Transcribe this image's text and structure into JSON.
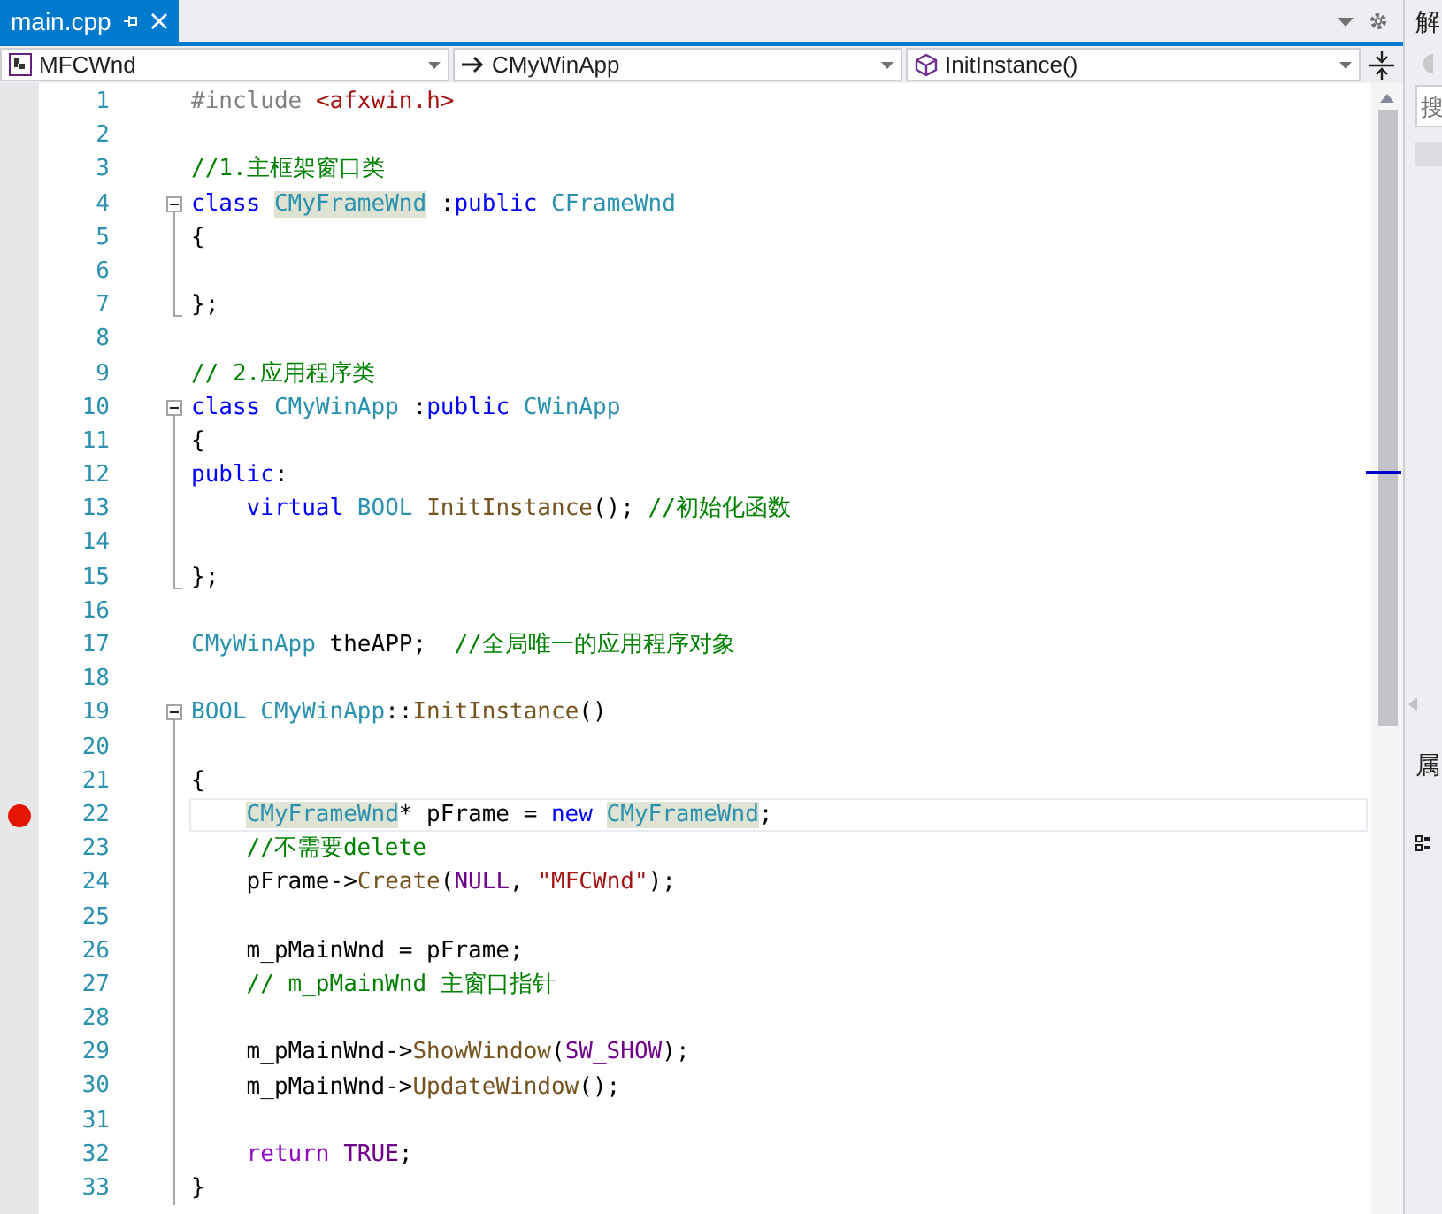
{
  "tabs": [
    {
      "label": "main.cpp",
      "selected": true
    }
  ],
  "navigation": [
    {
      "kind": "project",
      "text": "MFCWnd"
    },
    {
      "kind": "class",
      "text": "CMyWinApp"
    },
    {
      "kind": "member",
      "text": "InitInstance()"
    }
  ],
  "editor": {
    "lines": [
      {
        "number": "1",
        "breakpoint": false,
        "current": false,
        "kind": "plain",
        "indented": false,
        "tokens": [
          {
            "kind": "preproc",
            "text": "#include "
          },
          {
            "kind": "string",
            "text": "<afxwin.h>"
          }
        ]
      },
      {
        "number": "2",
        "breakpoint": false,
        "current": false,
        "kind": "plain"
      },
      {
        "number": "3",
        "breakpoint": false,
        "current": false,
        "kind": "plain",
        "indented": false,
        "tokens": [
          {
            "kind": "comment",
            "text": "//1.主框架窗口类"
          }
        ]
      },
      {
        "number": "4",
        "breakpoint": false,
        "current": false,
        "kind": "block-start",
        "indented": false,
        "tokens": [
          {
            "kind": "keyword",
            "text": "class "
          },
          {
            "kind": "type-ref",
            "text": "CMyFrameWnd"
          },
          {
            "kind": "plain",
            "text": " :"
          },
          {
            "kind": "keyword",
            "text": "public "
          },
          {
            "kind": "type",
            "text": "CFrameWnd"
          }
        ]
      },
      {
        "number": "5",
        "breakpoint": false,
        "current": false,
        "kind": "block-inside",
        "indented": false,
        "tokens": [
          {
            "kind": "plain",
            "text": "{"
          }
        ]
      },
      {
        "number": "6",
        "breakpoint": false,
        "current": false,
        "kind": "block-inside"
      },
      {
        "number": "7",
        "breakpoint": false,
        "current": false,
        "kind": "block-end",
        "indented": false,
        "tokens": [
          {
            "kind": "plain",
            "text": "};"
          }
        ]
      },
      {
        "number": "8",
        "breakpoint": false,
        "current": false,
        "kind": "plain"
      },
      {
        "number": "9",
        "breakpoint": false,
        "current": false,
        "kind": "plain",
        "indented": false,
        "tokens": [
          {
            "kind": "comment",
            "text": "// 2.应用程序类"
          }
        ]
      },
      {
        "number": "10",
        "breakpoint": false,
        "current": false,
        "kind": "block-start",
        "indented": false,
        "tokens": [
          {
            "kind": "keyword",
            "text": "class "
          },
          {
            "kind": "type",
            "text": "CMyWinApp"
          },
          {
            "kind": "plain",
            "text": " :"
          },
          {
            "kind": "keyword",
            "text": "public "
          },
          {
            "kind": "type",
            "text": "CWinApp"
          }
        ]
      },
      {
        "number": "11",
        "breakpoint": false,
        "current": false,
        "kind": "block-inside",
        "indented": false,
        "tokens": [
          {
            "kind": "plain",
            "text": "{"
          }
        ]
      },
      {
        "number": "12",
        "breakpoint": false,
        "current": false,
        "kind": "block-inside",
        "indented": false,
        "tokens": [
          {
            "kind": "keyword",
            "text": "public"
          },
          {
            "kind": "plain",
            "text": ":"
          }
        ]
      },
      {
        "number": "13",
        "breakpoint": false,
        "current": false,
        "kind": "block-inside",
        "indented": true,
        "tokens": [
          {
            "kind": "keyword",
            "text": "virtual "
          },
          {
            "kind": "type",
            "text": "BOOL "
          },
          {
            "kind": "function",
            "text": "InitInstance"
          },
          {
            "kind": "plain",
            "text": "(); "
          },
          {
            "kind": "comment",
            "text": "//初始化函数"
          }
        ]
      },
      {
        "number": "14",
        "breakpoint": false,
        "current": false,
        "kind": "block-inside"
      },
      {
        "number": "15",
        "breakpoint": false,
        "current": false,
        "kind": "block-end",
        "indented": false,
        "tokens": [
          {
            "kind": "plain",
            "text": "};"
          }
        ]
      },
      {
        "number": "16",
        "breakpoint": false,
        "current": false,
        "kind": "plain"
      },
      {
        "number": "17",
        "breakpoint": false,
        "current": false,
        "kind": "plain",
        "indented": false,
        "tokens": [
          {
            "kind": "type",
            "text": "CMyWinApp"
          },
          {
            "kind": "plain",
            "text": " theAPP;  "
          },
          {
            "kind": "comment",
            "text": "//全局唯一的应用程序对象"
          }
        ]
      },
      {
        "number": "18",
        "breakpoint": false,
        "current": false,
        "kind": "plain"
      },
      {
        "number": "19",
        "breakpoint": false,
        "current": false,
        "kind": "block-start",
        "indented": false,
        "tokens": [
          {
            "kind": "type",
            "text": "BOOL CMyWinApp"
          },
          {
            "kind": "plain",
            "text": "::"
          },
          {
            "kind": "function",
            "text": "InitInstance"
          },
          {
            "kind": "plain",
            "text": "()"
          }
        ]
      },
      {
        "number": "20",
        "breakpoint": false,
        "current": false,
        "kind": "block-inside"
      },
      {
        "number": "21",
        "breakpoint": false,
        "current": false,
        "kind": "block-inside",
        "indented": false,
        "tokens": [
          {
            "kind": "plain",
            "text": "{"
          }
        ]
      },
      {
        "number": "22",
        "breakpoint": true,
        "current": true,
        "kind": "block-inside",
        "indented": true,
        "tokens": [
          {
            "kind": "type-ref",
            "text": "CMyFrameWnd"
          },
          {
            "kind": "plain",
            "text": "* pFrame = "
          },
          {
            "kind": "keyword",
            "text": "new "
          },
          {
            "kind": "type-ref",
            "text": "CMyFrameWnd"
          },
          {
            "kind": "plain",
            "text": ";"
          }
        ]
      },
      {
        "number": "23",
        "breakpoint": false,
        "current": false,
        "kind": "block-inside",
        "indented": true,
        "tokens": [
          {
            "kind": "comment",
            "text": "//不需要delete"
          }
        ]
      },
      {
        "number": "24",
        "breakpoint": false,
        "current": false,
        "kind": "block-inside",
        "indented": true,
        "tokens": [
          {
            "kind": "plain",
            "text": "pFrame->"
          },
          {
            "kind": "function",
            "text": "Create"
          },
          {
            "kind": "plain",
            "text": "("
          },
          {
            "kind": "macro",
            "text": "NULL"
          },
          {
            "kind": "plain",
            "text": ", "
          },
          {
            "kind": "string",
            "text": "\"MFCWnd\""
          },
          {
            "kind": "plain",
            "text": ");"
          }
        ]
      },
      {
        "number": "25",
        "breakpoint": false,
        "current": false,
        "kind": "block-inside"
      },
      {
        "number": "26",
        "breakpoint": false,
        "current": false,
        "kind": "block-inside",
        "indented": true,
        "tokens": [
          {
            "kind": "plain",
            "text": "m_pMainWnd = pFrame;"
          }
        ]
      },
      {
        "number": "27",
        "breakpoint": false,
        "current": false,
        "kind": "block-inside",
        "indented": true,
        "tokens": [
          {
            "kind": "comment",
            "text": "// m_pMainWnd 主窗口指针"
          }
        ]
      },
      {
        "number": "28",
        "breakpoint": false,
        "current": false,
        "kind": "block-inside"
      },
      {
        "number": "29",
        "breakpoint": false,
        "current": false,
        "kind": "block-inside",
        "indented": true,
        "tokens": [
          {
            "kind": "plain",
            "text": "m_pMainWnd->"
          },
          {
            "kind": "function",
            "text": "ShowWindow"
          },
          {
            "kind": "plain",
            "text": "("
          },
          {
            "kind": "macro",
            "text": "SW_SHOW"
          },
          {
            "kind": "plain",
            "text": ");"
          }
        ]
      },
      {
        "number": "30",
        "breakpoint": false,
        "current": false,
        "kind": "block-inside",
        "indented": true,
        "tokens": [
          {
            "kind": "plain",
            "text": "m_pMainWnd->"
          },
          {
            "kind": "function",
            "text": "UpdateWindow"
          },
          {
            "kind": "plain",
            "text": "();"
          }
        ]
      },
      {
        "number": "31",
        "breakpoint": false,
        "current": false,
        "kind": "block-inside"
      },
      {
        "number": "32",
        "breakpoint": false,
        "current": false,
        "kind": "block-inside",
        "indented": true,
        "tokens": [
          {
            "kind": "control",
            "text": "return "
          },
          {
            "kind": "macro",
            "text": "TRUE"
          },
          {
            "kind": "plain",
            "text": ";"
          }
        ]
      },
      {
        "number": "33",
        "breakpoint": false,
        "current": false,
        "kind": "block-inside",
        "indented": false,
        "tokens": [
          {
            "kind": "plain",
            "text": "}"
          }
        ]
      }
    ]
  },
  "side_panel": {
    "title": "解",
    "search": {
      "placeholder": "搜"
    },
    "section": "属"
  }
}
